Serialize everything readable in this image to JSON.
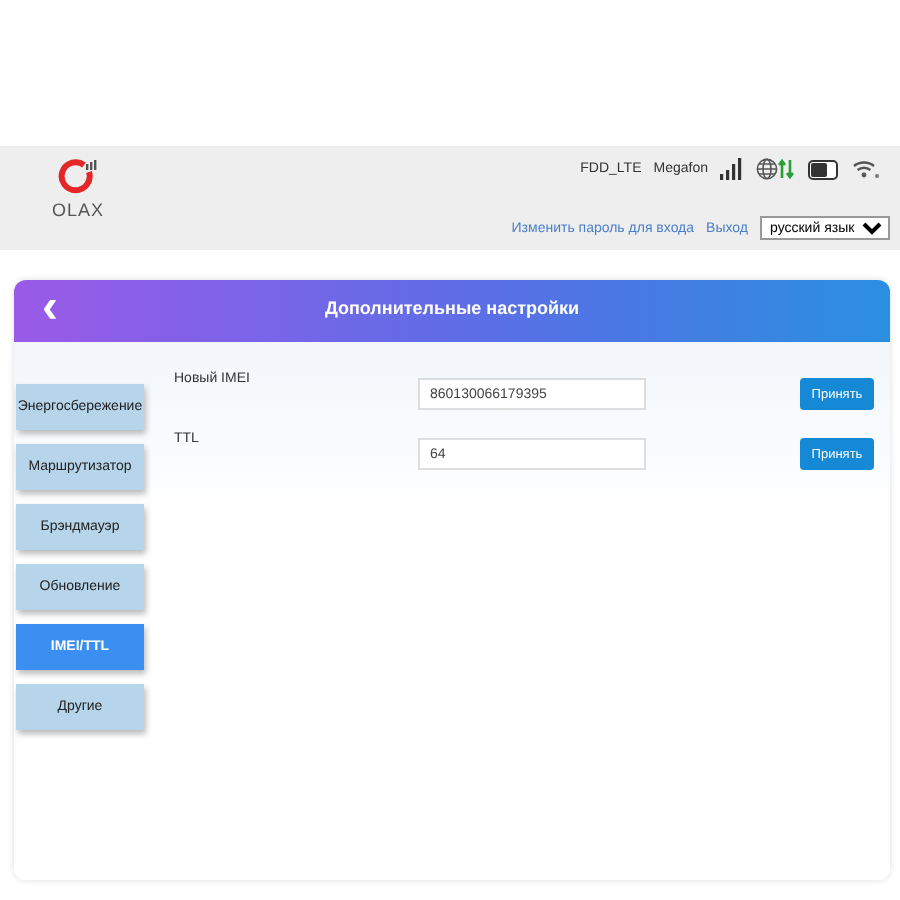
{
  "header": {
    "logo": "OLAX",
    "network_type": "FDD_LTE",
    "operator": "Megafon",
    "links": [
      "Изменить пароль для входа",
      "Выход"
    ],
    "language": "русский язык"
  },
  "panel": {
    "title": "Дополнительные настройки",
    "back": "‹"
  },
  "sidebar": {
    "items": [
      {
        "label": "Энергосбережение",
        "selected": false
      },
      {
        "label": "Маршрутизатор",
        "selected": false
      },
      {
        "label": "Брэндмауэр",
        "selected": false
      },
      {
        "label": "Обновление",
        "selected": false
      },
      {
        "label": "IMEI/TTL",
        "selected": true
      },
      {
        "label": "Другие",
        "selected": false
      }
    ]
  },
  "form": {
    "rows": [
      {
        "label": "Новый IMEI",
        "value": "860130066179395",
        "button": "Принять"
      },
      {
        "label": "TTL",
        "value": "64",
        "button": "Принять"
      }
    ]
  }
}
